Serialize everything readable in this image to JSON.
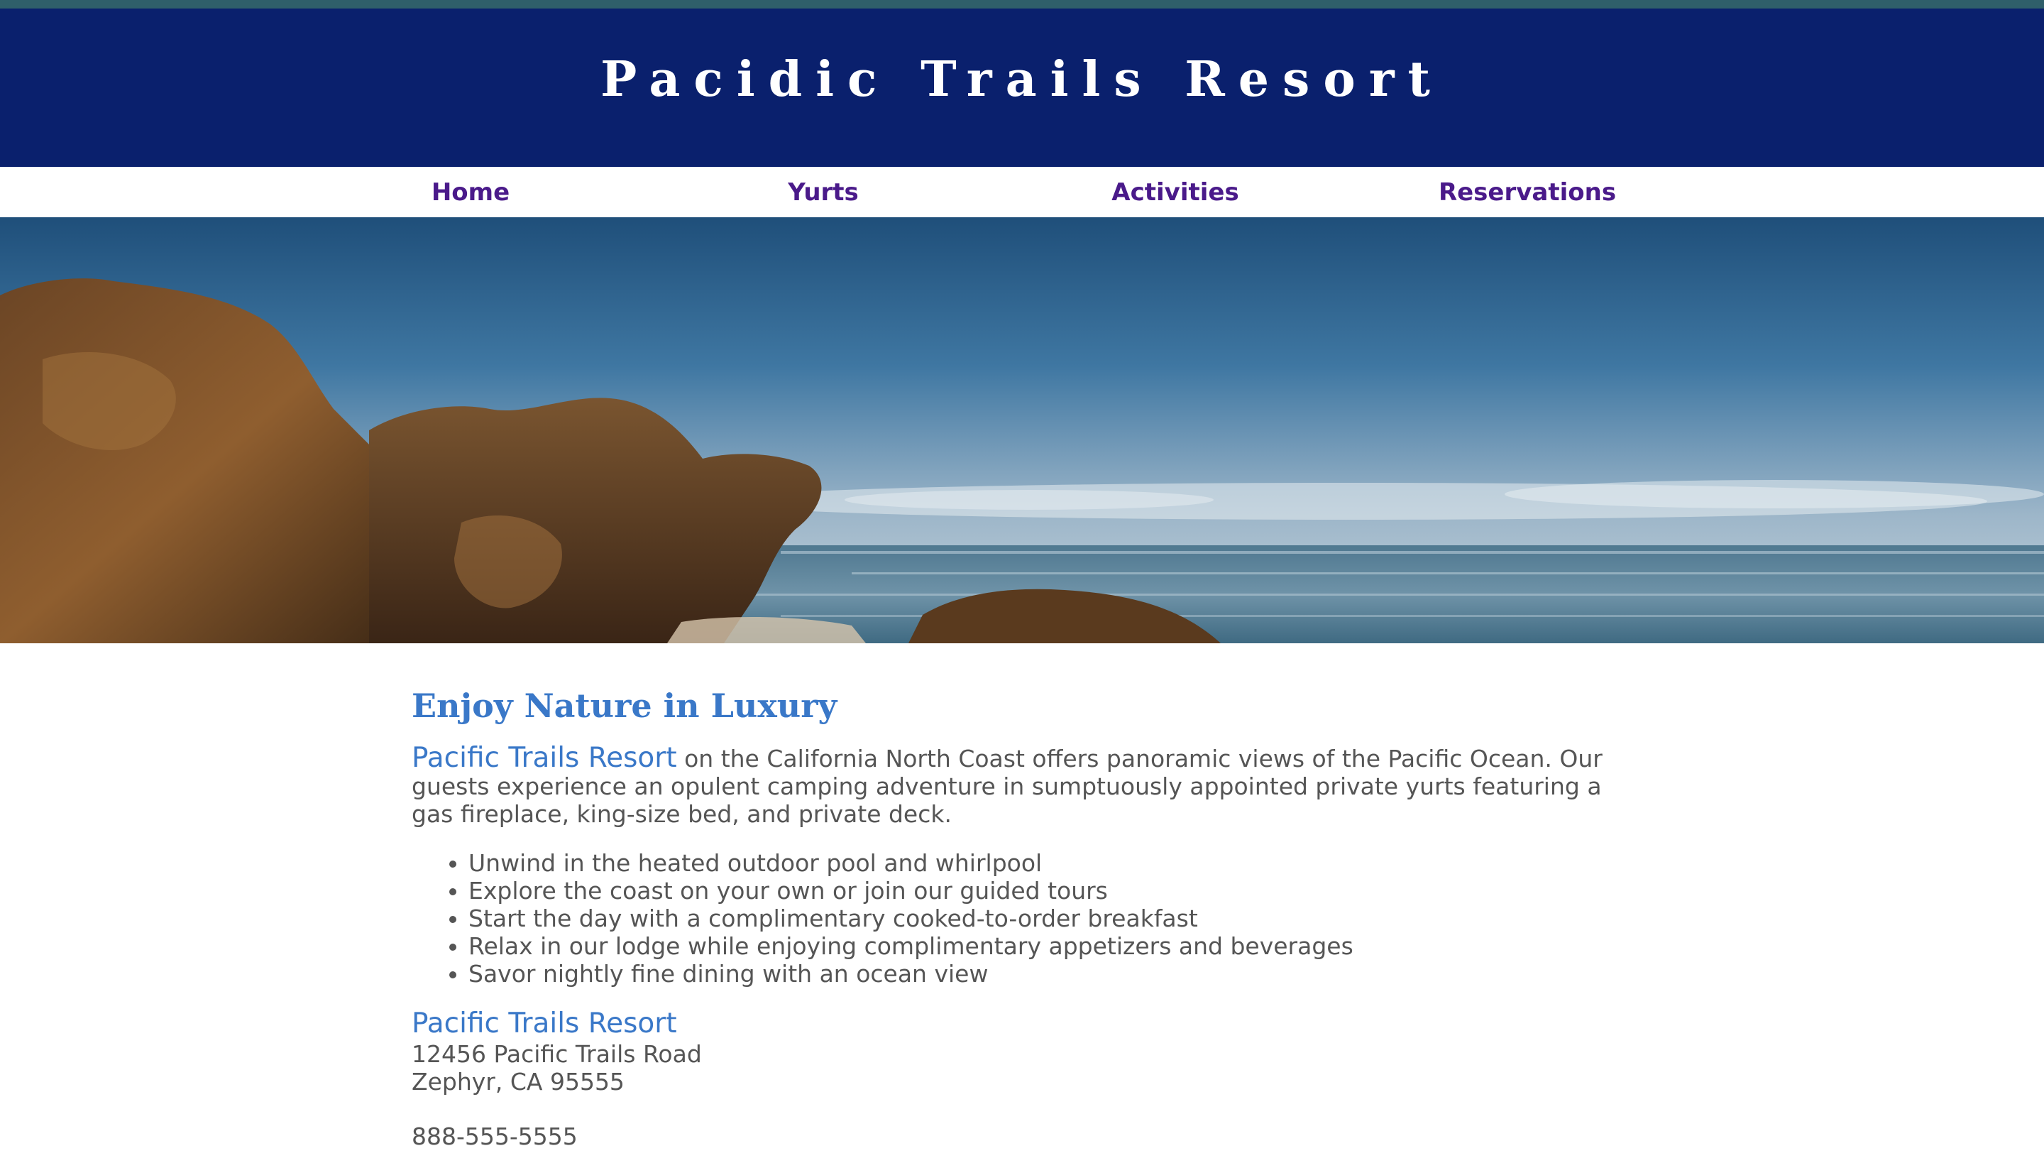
{
  "header": {
    "title": "Pacidic Trails Resort"
  },
  "nav": {
    "items": [
      {
        "label": "Home"
      },
      {
        "label": "Yurts"
      },
      {
        "label": "Activities"
      },
      {
        "label": "Reservations"
      }
    ]
  },
  "hero": {
    "image": "coastline-rocks-ocean"
  },
  "main": {
    "heading": "Enjoy Nature in Luxury",
    "intro_name": "Pacific Trails Resort",
    "intro_text": " on the California North Coast offers panoramic views of the Pacific Ocean. Our guests experience an opulent camping adventure in sumptuously appointed private yurts featuring a gas fireplace, king-size bed, and private deck.",
    "features": [
      "Unwind in the heated outdoor pool and whirlpool",
      "Explore the coast on your own or join our guided tours",
      "Start the day with a complimentary cooked-to-order breakfast",
      "Relax in our lodge while enjoying complimentary appetizers and beverages",
      "Savor nightly fine dining with an ocean view"
    ],
    "address": {
      "name": "Pacific Trails Resort",
      "street": "12456 Pacific Trails Road",
      "city": "Zephyr, CA 95555"
    },
    "phone": "888-555-5555"
  },
  "colors": {
    "header_bg": "#0a206d",
    "nav_link": "#4a1a8a",
    "accent": "#3a78c8",
    "text": "#555555"
  }
}
